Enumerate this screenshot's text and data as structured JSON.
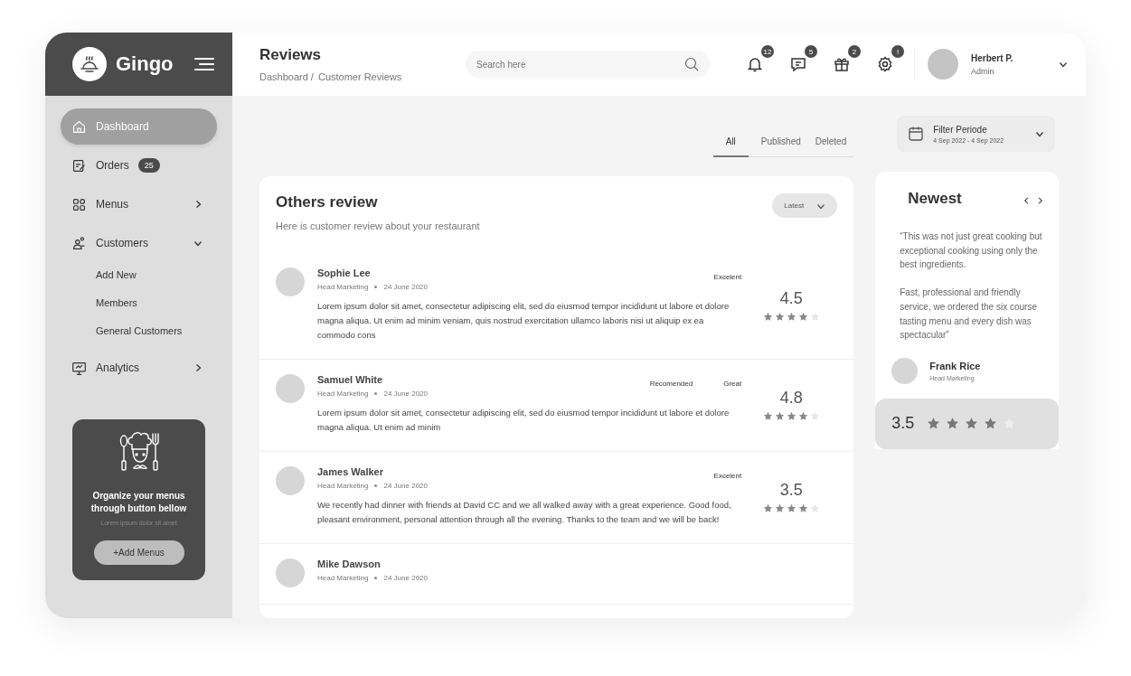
{
  "sidebar": {
    "logo": "Gingo",
    "items": [
      {
        "label": "Dashboard",
        "selected": true
      },
      {
        "label": "Orders",
        "badge": "25",
        "selected": false
      },
      {
        "label": "Menus",
        "expanded": false,
        "selected": false
      },
      {
        "label": "Customers",
        "selected": false,
        "expanded": true,
        "children": [
          {
            "label": "Add New"
          },
          {
            "label": "Members"
          },
          {
            "label": "General Customers"
          }
        ]
      },
      {
        "label": "Analytics",
        "expanded": false,
        "selected": false
      }
    ],
    "promo": {
      "title": "Organize your menus through button bellow",
      "text": "Lorem ipsum dolor sit amet",
      "button": "+Add Menus"
    }
  },
  "header": {
    "title": "Reviews",
    "breadcrumb": [
      "Dashboard /",
      "Customer Reviews"
    ],
    "search": {
      "placeholder": "Search here"
    },
    "notifications": [
      {
        "badge": "12"
      },
      {
        "badge": "5"
      },
      {
        "badge": "2"
      },
      {
        "badge": "!"
      }
    ],
    "user": {
      "name": "Herbert P.",
      "role": "Admin"
    }
  },
  "tabs": [
    {
      "label": "All",
      "selected": true
    },
    {
      "label": "Published",
      "selected": false
    },
    {
      "label": "Deleted",
      "selected": false
    }
  ],
  "filter": {
    "title": "Filter Periode",
    "range": "4 Sep 2022 - 4 Sep 2022"
  },
  "reviews_panel": {
    "title": "Others review",
    "subtitle": "Here is customer review about your restaurant",
    "sort": "Latest",
    "reviews": [
      {
        "name": "Sophie Lee",
        "role": "Head Marketing",
        "date": "24 June 2020",
        "tags": [
          "Excelent"
        ],
        "text": "Lorem ipsum dolor sit amet, consectetur adipiscing elit, sed do eiusmod tempor incididunt ut labore et dolore magna aliqua. Ut enim ad minim veniam, quis nostrud exercitation ullamco laboris nisi ut aliquip ex ea commodo cons",
        "rating": "4.5",
        "stars": 4
      },
      {
        "name": "Samuel White",
        "role": "Head Marketing",
        "date": "24 June 2020",
        "tags": [
          "Recomended",
          "Great"
        ],
        "text": "Lorem ipsum dolor sit amet, consectetur adipiscing elit, sed do eiusmod tempor incididunt ut labore et dolore magna aliqua. Ut enim ad minim",
        "rating": "4.8",
        "stars": 4
      },
      {
        "name": "James Walker",
        "role": "Head Marketing",
        "date": "24 June 2020",
        "tags": [
          "Excelent"
        ],
        "text": "We recently had dinner with friends at David CC and we all walked away with a great experience. Good food, pleasant environment, personal attention through all the evening. Thanks to the team and we will be back!",
        "rating": "3.5",
        "stars": 4
      },
      {
        "name": "Mike Dawson",
        "role": "Head Marketing",
        "date": "24 June 2020"
      }
    ]
  },
  "newest": {
    "title": "Newest",
    "quote": [
      "“This was not just great cooking but exceptional cooking using only the best ingredients.",
      "Fast, professional and friendly service, we ordered the six course tasting menu and every dish was spectacular”"
    ],
    "name": "Frank Rice",
    "role": "Head Marketing",
    "rating": "3.5",
    "stars": 4
  }
}
